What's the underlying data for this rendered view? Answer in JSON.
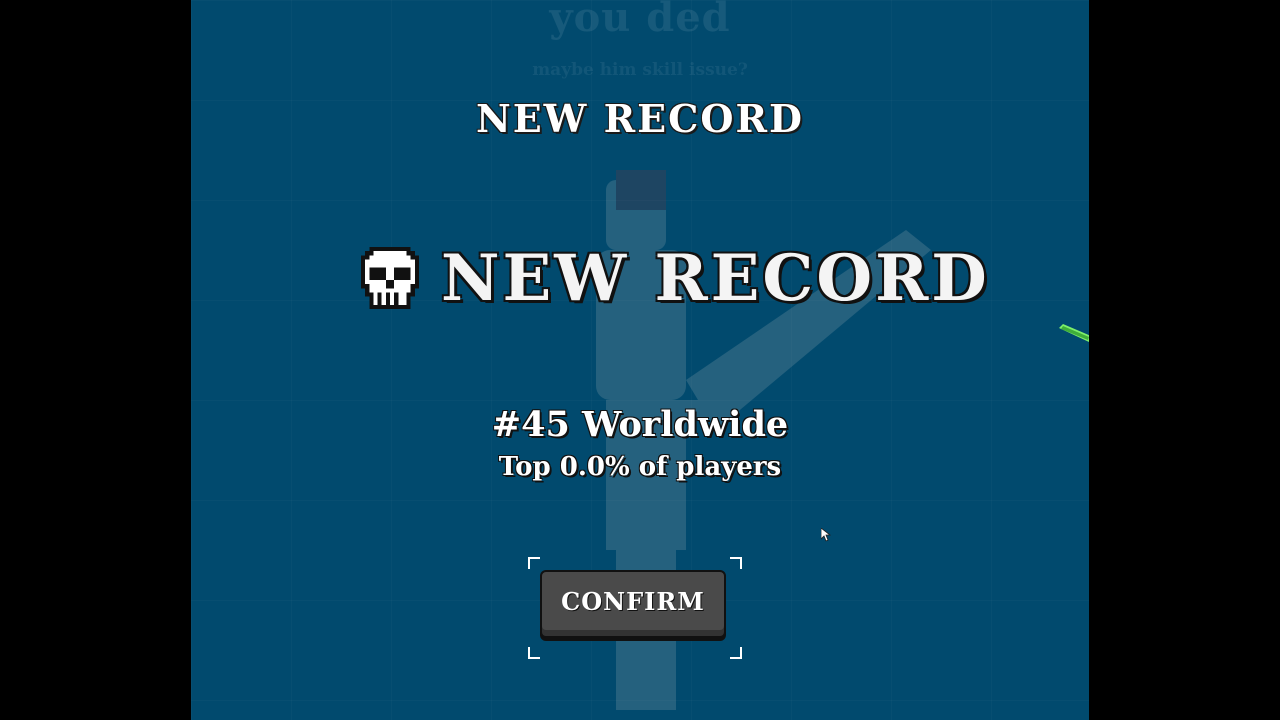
{
  "background_text": {
    "title": "you ded",
    "subtitle": "maybe him skill issue?"
  },
  "header": {
    "label": "NEW RECORD"
  },
  "banner": {
    "icon": "skull-icon",
    "label": "NEW RECORD"
  },
  "ranking": {
    "rank": "#45 Worldwide",
    "percentile": "Top 0.0% of players"
  },
  "confirm": {
    "label": "CONFIRM"
  },
  "colors": {
    "background": "#014a6e",
    "text": "#ffffff",
    "button": "#4a4a4a",
    "projectile": "#7ef06a"
  }
}
